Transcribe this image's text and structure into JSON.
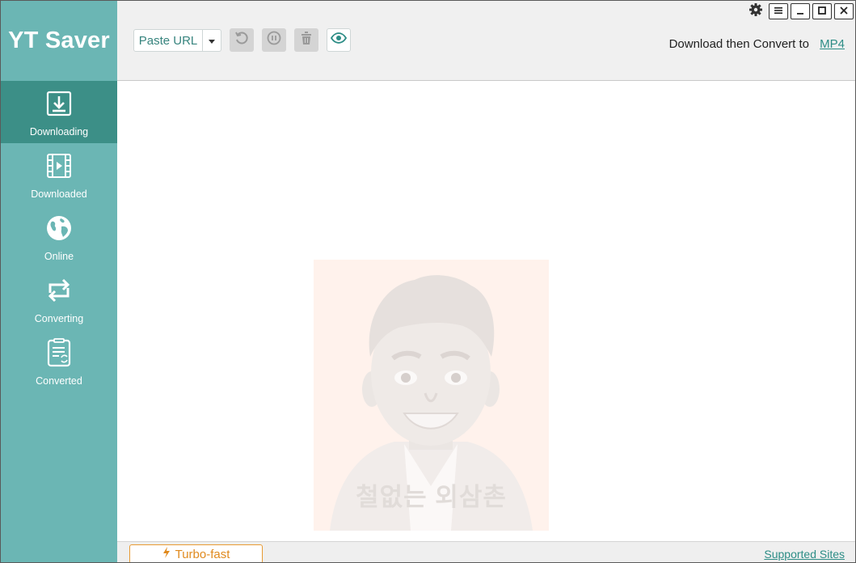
{
  "app": {
    "title": "YT Saver"
  },
  "sidebar": {
    "items": [
      {
        "label": "Downloading",
        "icon": "download-icon",
        "active": true
      },
      {
        "label": "Downloaded",
        "icon": "film-icon",
        "active": false
      },
      {
        "label": "Online",
        "icon": "globe-icon",
        "active": false
      },
      {
        "label": "Converting",
        "icon": "convert-arrows-icon",
        "active": false
      },
      {
        "label": "Converted",
        "icon": "converted-file-icon",
        "active": false
      }
    ]
  },
  "toolbar": {
    "paste_url_label": "Paste URL",
    "buttons": [
      "retry-icon",
      "pause-icon",
      "trash-icon",
      "eye-icon"
    ],
    "convert_label": "Download then Convert to",
    "convert_format": "MP4"
  },
  "window_controls": [
    "gear-icon",
    "menu-icon",
    "minimize-icon",
    "maximize-icon",
    "close-icon"
  ],
  "content": {
    "placeholder_text": "철없는 외삼촌"
  },
  "bottom": {
    "turbo_label": "Turbo-fast",
    "supported_sites_label": "Supported Sites"
  },
  "colors": {
    "sidebar": "#6bb6b4",
    "sidebar_active": "#3c8f87",
    "accent": "#2d8d86",
    "turbo": "#e08a1e"
  }
}
